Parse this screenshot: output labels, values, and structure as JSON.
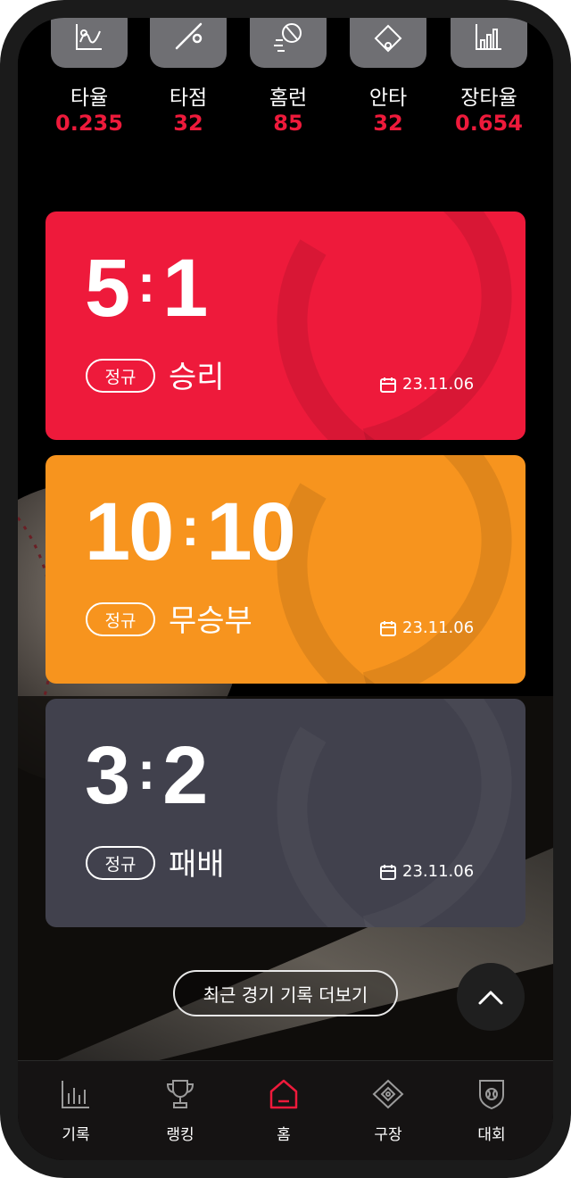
{
  "stats": [
    {
      "label": "타율",
      "value": "0.235",
      "icon": "chart-icon"
    },
    {
      "label": "타점",
      "value": "32",
      "icon": "bat-icon"
    },
    {
      "label": "홈런",
      "value": "85",
      "icon": "baseball-icon"
    },
    {
      "label": "안타",
      "value": "32",
      "icon": "diamond-icon"
    },
    {
      "label": "장타율",
      "value": "0.654",
      "icon": "bar-chart-icon"
    }
  ],
  "games": [
    {
      "home": "5",
      "away": "1",
      "type": "정규",
      "result": "승리",
      "date": "23.11.06",
      "color": "#ee1a3b"
    },
    {
      "home": "10",
      "away": "10",
      "type": "정규",
      "result": "무승부",
      "date": "23.11.06",
      "color": "#f7941e"
    },
    {
      "home": "3",
      "away": "2",
      "type": "정규",
      "result": "패배",
      "date": "23.11.06",
      "color": "#41414d"
    }
  ],
  "more_button": "최근 경기 기록 더보기",
  "tabs": [
    {
      "label": "기록",
      "icon": "stats-icon",
      "active": false
    },
    {
      "label": "랭킹",
      "icon": "trophy-icon",
      "active": false
    },
    {
      "label": "홈",
      "icon": "home-icon",
      "active": true
    },
    {
      "label": "구장",
      "icon": "field-icon",
      "active": false
    },
    {
      "label": "대회",
      "icon": "shield-icon",
      "active": false
    }
  ],
  "colors": {
    "accent": "#ee1a3b",
    "win": "#ee1a3b",
    "draw": "#f7941e",
    "loss": "#41414d"
  }
}
